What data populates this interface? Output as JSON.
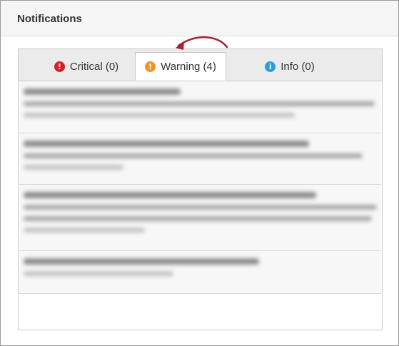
{
  "panel": {
    "title": "Notifications"
  },
  "tabs": [
    {
      "label": "Critical (0)",
      "icon": "critical-icon",
      "icon_glyph": "!",
      "icon_color": "#e01b22",
      "active": false
    },
    {
      "label": "Warning (4)",
      "icon": "warning-icon",
      "icon_glyph": "!",
      "icon_color": "#f29423",
      "active": true
    },
    {
      "label": "Info (0)",
      "icon": "info-icon",
      "icon_glyph": "i",
      "icon_color": "#2a9fe0",
      "active": false
    }
  ],
  "annotation": {
    "arrow_color": "#b21e2e"
  }
}
